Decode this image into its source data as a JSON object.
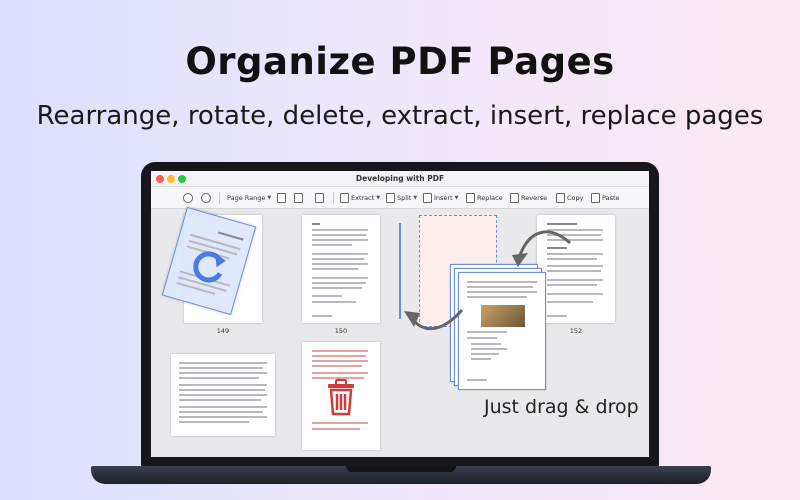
{
  "hero": {
    "title": "Organize PDF Pages",
    "subtitle": "Rearrange, rotate, delete, extract, insert, replace pages"
  },
  "window": {
    "title": "Developing with PDF"
  },
  "toolbar": {
    "zoom_in_icon": "zoom-in-icon",
    "zoom_out_icon": "zoom-out-icon",
    "page_range": "Page Range",
    "extract": "Extract",
    "split": "Split",
    "insert": "Insert",
    "replace": "Replace",
    "reverse": "Reverse",
    "copy": "Copy",
    "paste": "Paste"
  },
  "pages": {
    "p149": "149",
    "p150": "150",
    "p152": "152"
  },
  "hint": "Just drag & drop",
  "colors": {
    "accent": "#6b8fd8",
    "delete": "#d23a3a",
    "placeholder": "#fdeeee"
  }
}
